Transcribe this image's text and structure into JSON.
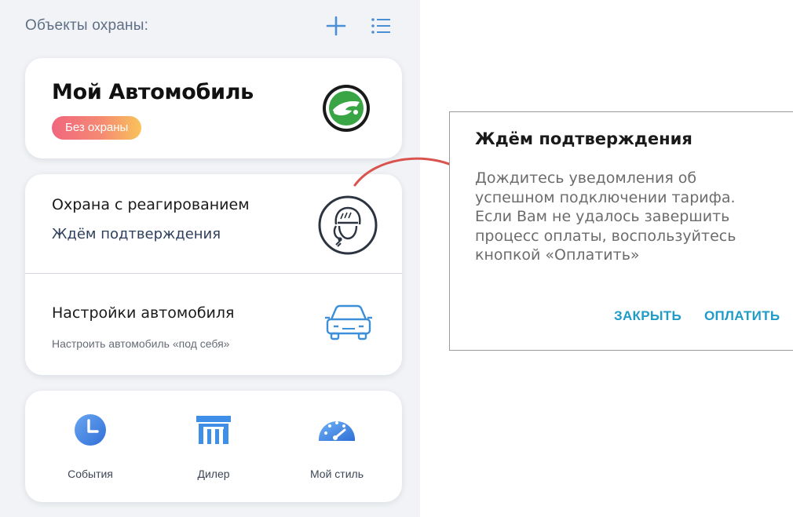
{
  "header": {
    "title": "Объекты охраны:"
  },
  "car_card": {
    "name": "Мой Автомобиль",
    "status_badge": "Без охраны"
  },
  "security_service": {
    "title": "Охрана с реагированием",
    "status": "Ждём подтверждения"
  },
  "car_settings": {
    "title": "Настройки автомобиля",
    "subtitle": "Настроить автомобиль «под себя»"
  },
  "bottom_menu": {
    "items": [
      {
        "label": "События",
        "icon": "clock-icon"
      },
      {
        "label": "Дилер",
        "icon": "dealer-building-icon"
      },
      {
        "label": "Мой стиль",
        "icon": "speedometer-icon"
      }
    ]
  },
  "dialog": {
    "title": "Ждём подтверждения",
    "body_lines": [
      "Дождитесь уведомления об",
      "успешном подключении тарифа.",
      "Если Вам не удалось завершить",
      "процесс оплаты, воспользуйтесь",
      "кнопкой «Оплатить»"
    ],
    "close_label": "ЗАКРЫТЬ",
    "pay_label": "ОПЛАТИТЬ"
  },
  "colors": {
    "accent_blue": "#1f9bc7",
    "badge_gradient": [
      "#f0667e",
      "#f9c35a"
    ],
    "arrow_red": "#d9534f"
  }
}
